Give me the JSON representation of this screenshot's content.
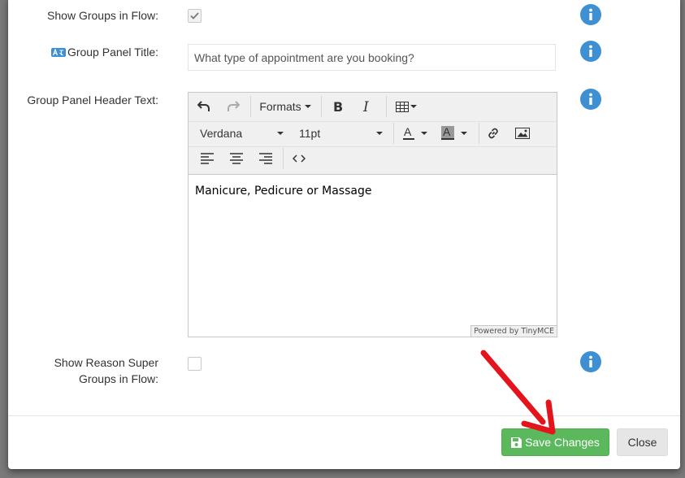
{
  "form": {
    "show_groups_label": "Show Groups in Flow:",
    "show_groups_checked": true,
    "group_panel_title_label": "Group Panel Title:",
    "group_panel_title_value": "What type of appointment are you booking?",
    "header_text_label": "Group Panel Header Text:",
    "reason_super_label_line1": "Show Reason Super",
    "reason_super_label_line2": "Groups in Flow:",
    "reason_super_checked": false
  },
  "editor": {
    "formats_label": "Formats",
    "font_family": "Verdana",
    "font_size": "11pt",
    "content": "Manicure, Pedicure or Massage",
    "powered_by": "Powered by TinyMCE"
  },
  "footer": {
    "save_label": "Save Changes",
    "close_label": "Close"
  },
  "colors": {
    "info_blue": "#3f8fd3",
    "save_green": "#5cb85c",
    "arrow_red": "#e3141b"
  },
  "icons": [
    "info-icon",
    "translate-icon",
    "undo-icon",
    "redo-icon",
    "bold-icon",
    "italic-icon",
    "table-icon",
    "text-color-icon",
    "background-color-icon",
    "link-icon",
    "image-icon",
    "align-left-icon",
    "align-center-icon",
    "align-right-icon",
    "code-icon",
    "floppy-disk-icon",
    "arrow-annotation"
  ]
}
